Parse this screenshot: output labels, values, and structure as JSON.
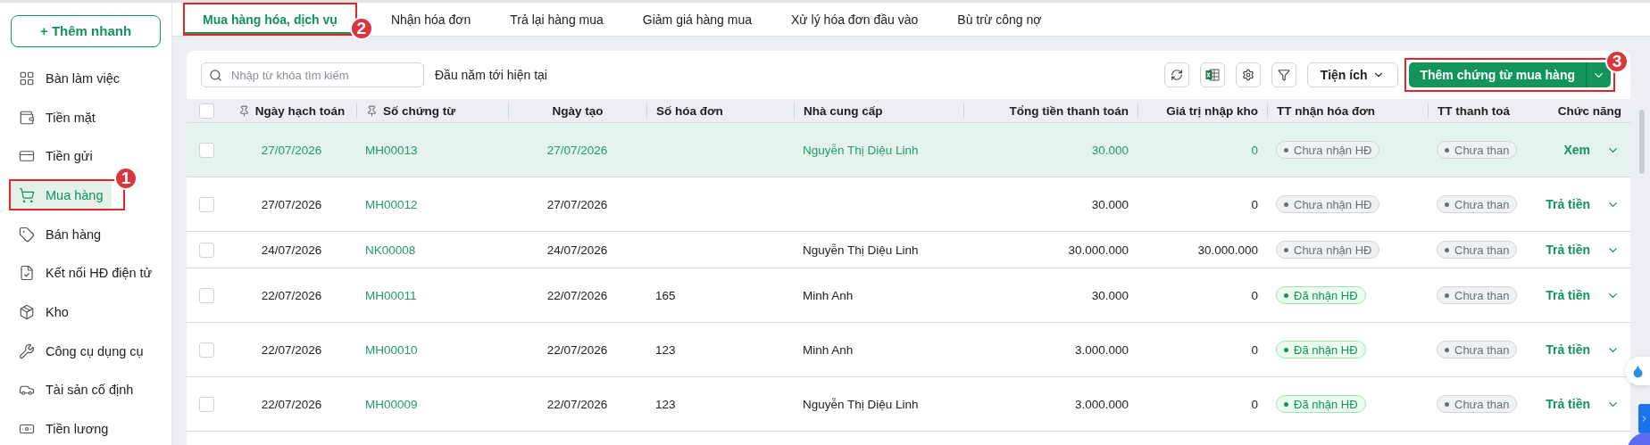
{
  "sidebar": {
    "quick_add": "+ Thêm nhanh",
    "items": [
      {
        "label": "Bàn làm việc",
        "selected": false
      },
      {
        "label": "Tiền mặt",
        "selected": false
      },
      {
        "label": "Tiền gửi",
        "selected": false
      },
      {
        "label": "Mua hàng",
        "selected": true,
        "annotation": "1"
      },
      {
        "label": "Bán hàng",
        "selected": false
      },
      {
        "label": "Kết nối HĐ điện tử",
        "selected": false
      },
      {
        "label": "Kho",
        "selected": false
      },
      {
        "label": "Công cụ dụng cụ",
        "selected": false
      },
      {
        "label": "Tài sản cố định",
        "selected": false
      },
      {
        "label": "Tiền lương",
        "selected": false
      }
    ]
  },
  "tabs": [
    {
      "label": "Mua hàng hóa, dịch vụ",
      "selected": true,
      "annotation": "2"
    },
    {
      "label": "Nhận hóa đơn",
      "selected": false
    },
    {
      "label": "Trả lại hàng mua",
      "selected": false
    },
    {
      "label": "Giảm giá hàng mua",
      "selected": false
    },
    {
      "label": "Xử lý hóa đơn đầu vào",
      "selected": false
    },
    {
      "label": "Bù trừ công nợ",
      "selected": false
    }
  ],
  "toolbar": {
    "search": {
      "placeholder": "Nhập từ khóa tìm kiếm"
    },
    "period": "Đầu năm tới hiện tại",
    "utilities": "Tiện ích",
    "add_button": {
      "label": "Thêm chứng từ mua hàng",
      "annotation": "3"
    }
  },
  "table": {
    "columns": [
      {
        "label": "Ngày hạch toán",
        "pinned": true
      },
      {
        "label": "Số chứng từ",
        "pinned": true
      },
      {
        "label": "Ngày tạo",
        "pinned": false
      },
      {
        "label": "Số hóa đơn",
        "pinned": false
      },
      {
        "label": "Nhà cung cấp",
        "pinned": false
      },
      {
        "label": "Tổng tiền thanh toán",
        "pinned": false
      },
      {
        "label": "Giá trị nhập kho",
        "pinned": false
      },
      {
        "label": "TT nhận hóa đơn",
        "pinned": false
      },
      {
        "label": "TT thanh toá",
        "pinned": false
      },
      {
        "label": "Chức năng",
        "pinned": false
      }
    ],
    "select_all_checked": false,
    "rows": [
      {
        "selected": true,
        "checked": false,
        "date": "27/07/2026",
        "voucher": "MH00013",
        "created": "27/07/2026",
        "invoice_no": "",
        "supplier": "Nguyễn Thị Diệu Linh",
        "total": "30.000",
        "stock_value": "0",
        "invoice_status": {
          "kind": "pending",
          "label": "Chưa nhận HĐ"
        },
        "payment_status": "Chưa than",
        "action": "Xem"
      },
      {
        "selected": false,
        "checked": false,
        "date": "27/07/2026",
        "voucher": "MH00012",
        "created": "27/07/2026",
        "invoice_no": "",
        "supplier": "",
        "total": "30.000",
        "stock_value": "0",
        "invoice_status": {
          "kind": "pending",
          "label": "Chưa nhận HĐ"
        },
        "payment_status": "Chưa than",
        "action": "Trả tiền"
      },
      {
        "selected": false,
        "checked": false,
        "date": "24/07/2026",
        "voucher": "NK00008",
        "created": "24/07/2026",
        "invoice_no": "",
        "supplier": "Nguyễn Thị Diệu Linh",
        "total": "30.000.000",
        "stock_value": "30.000.000",
        "invoice_status": {
          "kind": "pending",
          "label": "Chưa nhận HĐ"
        },
        "payment_status": "Chưa than",
        "action": "Trả tiền"
      },
      {
        "selected": false,
        "checked": false,
        "date": "22/07/2026",
        "voucher": "MH00011",
        "created": "22/07/2026",
        "invoice_no": "165",
        "supplier": "Minh Anh",
        "total": "30.000",
        "stock_value": "0",
        "invoice_status": {
          "kind": "received",
          "label": "Đã nhận HĐ"
        },
        "payment_status": "Chưa than",
        "action": "Trả tiền"
      },
      {
        "selected": false,
        "checked": false,
        "date": "22/07/2026",
        "voucher": "MH00010",
        "created": "22/07/2026",
        "invoice_no": "123",
        "supplier": "Minh Anh",
        "total": "3.000.000",
        "stock_value": "0",
        "invoice_status": {
          "kind": "received",
          "label": "Đã nhận HĐ"
        },
        "payment_status": "Chưa than",
        "action": "Trả tiền"
      },
      {
        "selected": false,
        "checked": false,
        "date": "22/07/2026",
        "voucher": "MH00009",
        "created": "22/07/2026",
        "invoice_no": "123",
        "supplier": "Nguyễn Thị Diệu Linh",
        "total": "3.000.000",
        "stock_value": "0",
        "invoice_status": {
          "kind": "received",
          "label": "Đã nhận HĐ"
        },
        "payment_status": "Chưa than",
        "action": "Trả tiền"
      }
    ]
  }
}
